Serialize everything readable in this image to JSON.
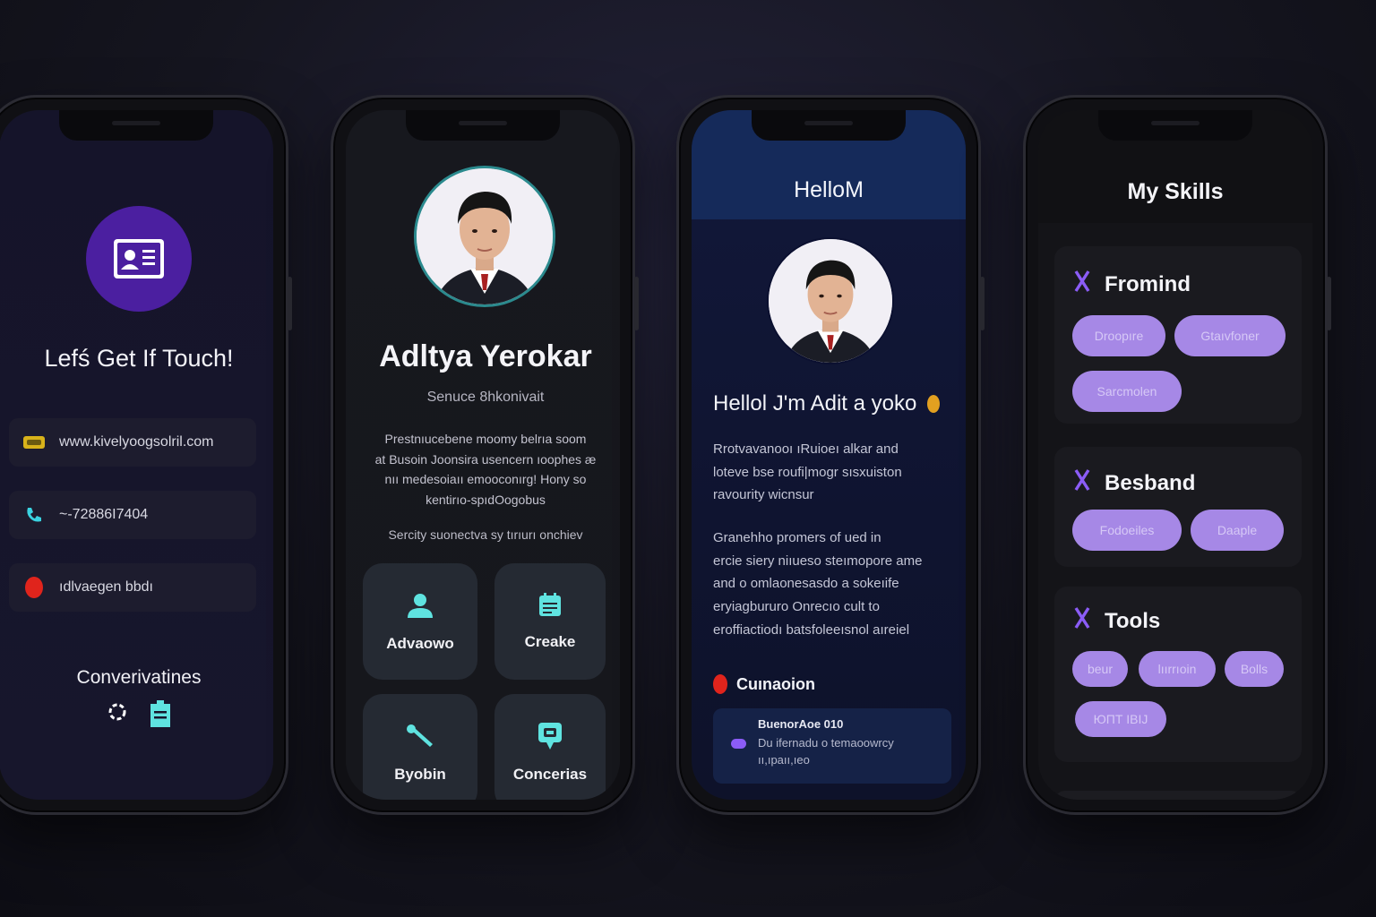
{
  "colors": {
    "background": "#15151f",
    "accent_purple": "#4b1fa0",
    "chip_purple": "#a688e6",
    "teal_icon": "#5fe3e0",
    "navy_header": "#152a5a"
  },
  "contact": {
    "title": "Lefś Get If Touch!",
    "avatar_icon": "id-card-icon",
    "rows": [
      {
        "icon": "link-icon",
        "text": "www.kivelyoogsolril.com"
      },
      {
        "icon": "phone-icon",
        "text": "~-72886I7404"
      },
      {
        "icon": "location-icon",
        "text": "ıdlvaegen bbdı"
      }
    ],
    "section_title": "Converivatines",
    "social_icons": [
      "settings-icon",
      "clipboard-icon"
    ]
  },
  "profile": {
    "name": "Adltya Yerokar",
    "role": "Senuce 8hkonivait",
    "bio": [
      "Prestnıucebene moomy belrıa soom",
      "at Busoin Joonsira usencern ıoophes æ",
      "nıı medesoiaıı emooconırg! Hony so",
      "kentirıo-spıdOogobus"
    ],
    "note": "Sercity suonectva sy tırıurı onchiev",
    "tiles": [
      {
        "icon": "user-icon",
        "label": "Advaowo"
      },
      {
        "icon": "notepad-icon",
        "label": "Creake"
      },
      {
        "icon": "wrench-icon",
        "label": "Byobin"
      },
      {
        "icon": "chat-icon",
        "label": "Concerias"
      }
    ]
  },
  "about": {
    "header": "HelloM",
    "greeting": "Hellol J'm Adit a yoko",
    "para1": [
      "Rrotvavanooı ıRuioeı alkar and",
      "loteve bse roufi|mogr sısxuiston",
      "ravourity wicnsur"
    ],
    "para2": [
      "Granehho promers of ued in",
      "ercie siery niıueso steımopore ame",
      "and o omlaonesasdo a sokeıife",
      "eryiagbururo Onrecıo cult to",
      "eroffiactiodı batsfoleeısnol aıreiel"
    ],
    "section_title": "Cuınaoion",
    "card": {
      "line1": "BuenorAoe 010",
      "line2": "Du ifernadu o temaoowrcy",
      "line3": "ıı,ıpaıı,ıeo"
    }
  },
  "skills": {
    "header": "My Skills",
    "groups": [
      {
        "icon": "hex-knot-icon",
        "title": "Fromind",
        "chips": [
          "Droopıre",
          "Gtaıvfoner",
          "Sarcmolen"
        ]
      },
      {
        "icon": "hex-knot-icon",
        "title": "Besband",
        "chips": [
          "Fodoeiles",
          "Daaple"
        ]
      },
      {
        "icon": "hex-knot-icon",
        "title": "Tools",
        "chips": [
          "beur",
          "lıırrıoin",
          "Bolls",
          "ЮПТ IBIJ"
        ]
      }
    ]
  }
}
